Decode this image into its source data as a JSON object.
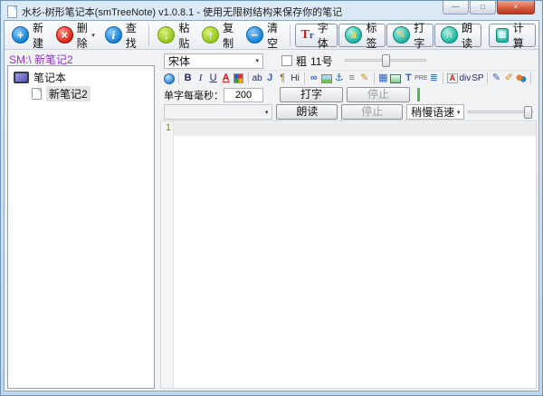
{
  "window": {
    "title": "水杉-树形笔记本(smTreeNote) v1.0.8.1 - 使用无限树结构来保存你的笔记",
    "controls": {
      "minimize": "—",
      "maximize": "□",
      "close": "×"
    }
  },
  "glyphs": {
    "combo_arrow": "▾",
    "dropdown_arrow": "▾"
  },
  "toolbar": {
    "buttons": [
      {
        "label": "新建",
        "glyph": "+"
      },
      {
        "label": "删除",
        "glyph": "×"
      },
      {
        "label": "查找",
        "glyph": "i"
      },
      {
        "label": "粘贴",
        "glyph": "↓"
      },
      {
        "label": "复制",
        "glyph": "↑"
      },
      {
        "label": "清空",
        "glyph": "−"
      },
      {
        "label": "字体",
        "glyph_t": "T",
        "glyph_r": "r"
      },
      {
        "label": "标签",
        "glyph": "a"
      },
      {
        "label": "打字",
        "glyph": "✎"
      },
      {
        "label": "朗读",
        "glyph": "∩"
      },
      {
        "label": "计算",
        "glyph": "▦"
      }
    ]
  },
  "path_bar": {
    "text": "SM:\\ 新笔记2"
  },
  "tree": {
    "root_label": "笔记本",
    "note_label": "新笔记2"
  },
  "format_row": {
    "font_family": "宋体",
    "bold_label": "粗",
    "size_label": "11号"
  },
  "icon_strip": {
    "items": [
      {
        "name": "globe",
        "glyph": ""
      },
      {
        "name": "bold",
        "glyph": "B"
      },
      {
        "name": "italic",
        "glyph": "I"
      },
      {
        "name": "underline",
        "glyph": "U"
      },
      {
        "name": "font-color",
        "glyph": "A"
      },
      {
        "name": "palette",
        "glyph": ""
      },
      {
        "name": "highlight",
        "glyph": "ab"
      },
      {
        "name": "insert-j",
        "glyph": "J"
      },
      {
        "name": "pilcrow",
        "glyph": "¶"
      },
      {
        "name": "superscript",
        "glyph": "Hi"
      },
      {
        "name": "link",
        "glyph": "∞"
      },
      {
        "name": "image",
        "glyph": ""
      },
      {
        "name": "anchor",
        "glyph": "⚓"
      },
      {
        "name": "hr",
        "glyph": "≡"
      },
      {
        "name": "edit-pencil",
        "glyph": "✎"
      },
      {
        "name": "table",
        "glyph": "▦"
      },
      {
        "name": "media",
        "glyph": ""
      },
      {
        "name": "text-t",
        "glyph": "T"
      },
      {
        "name": "pre",
        "glyph": "PRE"
      },
      {
        "name": "list",
        "glyph": "≣"
      },
      {
        "name": "a-style",
        "glyph": "A"
      },
      {
        "name": "div",
        "glyph": "div"
      },
      {
        "name": "sp",
        "glyph": "SP"
      },
      {
        "name": "note-edit",
        "glyph": "✎"
      },
      {
        "name": "pen",
        "glyph": "✐"
      },
      {
        "name": "users",
        "glyph": ""
      }
    ]
  },
  "typing_row": {
    "label": "单字每毫秒：",
    "ms_value": "200",
    "type_button": "打字",
    "stop_button": "停止"
  },
  "reading_row": {
    "read_button": "朗读",
    "stop_button": "停止",
    "speed_value": "稍慢语速"
  },
  "editor": {
    "line_number": "1"
  }
}
